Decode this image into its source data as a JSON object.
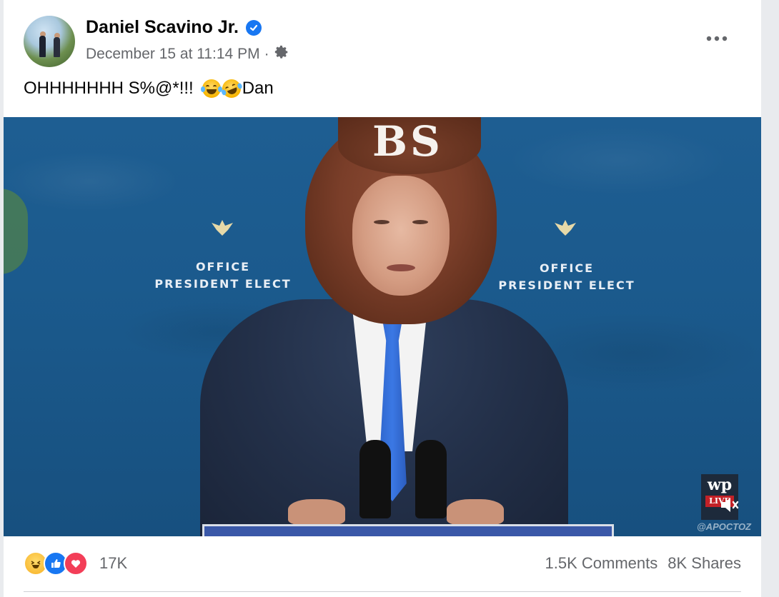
{
  "post": {
    "author": "Daniel Scavino Jr.",
    "timestamp": "December 15 at 11:14 PM",
    "separator": "·",
    "text": "OHHHHHHH S%@*!!!",
    "signoff": "Dan"
  },
  "video": {
    "overlay_text": "BS",
    "backdrop_left": {
      "line1": "OFFICE",
      "line2": "PRESIDENT ELECT"
    },
    "backdrop_right": {
      "line1": "OFFICE",
      "line2": "PRESIDENT ELECT"
    },
    "watermark": "@APOCTOZ",
    "badge": "wp",
    "badge_sub": "LIVE"
  },
  "footer": {
    "reaction_count": "17K",
    "comments": "1.5K Comments",
    "shares": "8K Shares"
  },
  "icons": {
    "verified": "verified-badge-icon",
    "audience": "gear-icon",
    "more": "more-options-icon",
    "reactions": [
      "haha-icon",
      "like-icon",
      "love-icon"
    ]
  },
  "colors": {
    "brand_blue": "#1877f2",
    "text_secondary": "#65676b",
    "love": "#f33e58"
  }
}
